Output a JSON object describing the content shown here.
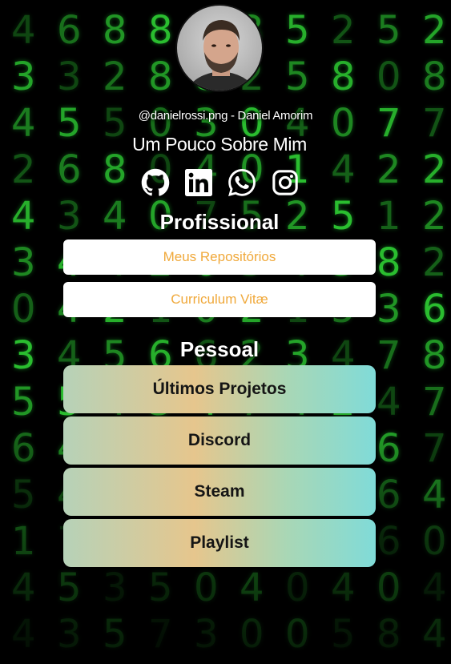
{
  "profile": {
    "avatar_alt": "avatar",
    "username_line": "@danielrossi.png - Daniel Amorim",
    "about_label": "Um Pouco Sobre Mim"
  },
  "socials": [
    {
      "name": "github-icon"
    },
    {
      "name": "linkedin-icon"
    },
    {
      "name": "whatsapp-icon"
    },
    {
      "name": "instagram-icon"
    }
  ],
  "professional": {
    "title": "Profissional",
    "buttons": [
      "Meus Repositórios",
      "Curriculum Vitæ"
    ]
  },
  "personal": {
    "title": "Pessoal",
    "buttons": [
      "Últimos Projetos",
      "Discord",
      "Steam",
      "Playlist"
    ]
  },
  "background": {
    "digit_rows": [
      "4688835252",
      "3328825808",
      "4550304077",
      "2680401422",
      "4340752512",
      "3442054382",
      "0421021536",
      "3456623478",
      "5543474247",
      "6435437467",
      "5412573364",
      "1787060860",
      "4535040404",
      "4357300584"
    ]
  },
  "colors": {
    "pro_text": "#f0a93b",
    "matrix_green": "#2dc832"
  }
}
